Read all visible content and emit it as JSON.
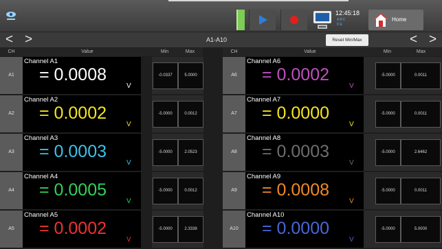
{
  "toolbar": {
    "time": "12:45:18",
    "status_lines": [
      "ABC",
      "DE"
    ],
    "home_label": "Home",
    "icons": [
      "eye-icon",
      "play-icon",
      "record-icon",
      "computer-icon",
      "home-icon"
    ],
    "accent": "#7ecb55"
  },
  "nav": {
    "range": "A1-A10",
    "reset_label": "Reset Min/Max",
    "prev": "<",
    "next": ">"
  },
  "headers": {
    "ch": "CH",
    "value": "Value",
    "min": "Min",
    "max": "Max"
  },
  "channels_left": [
    {
      "id": "A1",
      "name": "Channel A1",
      "value": "= 0.0008",
      "unit": "V",
      "min": "-0.0337",
      "max": "5.0000",
      "color": "#ffffff",
      "unit_color": "#ffffff"
    },
    {
      "id": "A2",
      "name": "Channel A2",
      "value": "= 0.0002",
      "unit": "V",
      "min": "-5.0000",
      "max": "0.0012",
      "color": "#f5e61e",
      "unit_color": "#f5e61e"
    },
    {
      "id": "A3",
      "name": "Channel A3",
      "value": "= 0.0003",
      "unit": "V",
      "min": "-5.0000",
      "max": "2.0523",
      "color": "#3bc3e8",
      "unit_color": "#3bc3e8"
    },
    {
      "id": "A4",
      "name": "Channel A4",
      "value": "= 0.0005",
      "unit": "V",
      "min": "-5.0000",
      "max": "0.0012",
      "color": "#32d05a",
      "unit_color": "#32d05a"
    },
    {
      "id": "A5",
      "name": "Channel A5",
      "value": "= 0.0002",
      "unit": "V",
      "min": "-5.0000",
      "max": "2.3338",
      "color": "#ef3232",
      "unit_color": "#ef3232"
    }
  ],
  "channels_right": [
    {
      "id": "A6",
      "name": "Channel A6",
      "value": "= 0.0002",
      "unit": "V",
      "min": "-5.0000",
      "max": "0.0011",
      "color": "#c04fc0",
      "unit_color": "#c04fc0"
    },
    {
      "id": "A7",
      "name": "Channel A7",
      "value": "= 0.0000",
      "unit": "V",
      "min": "-5.0000",
      "max": "0.0011",
      "color": "#f5e61e",
      "unit_color": "#f5e61e"
    },
    {
      "id": "A8",
      "name": "Channel A8",
      "value": "= 0.0003",
      "unit": "V",
      "min": "-5.0000",
      "max": "2.6462",
      "color": "#6e6e6e",
      "unit_color": "#6e6e6e"
    },
    {
      "id": "A9",
      "name": "Channel A9",
      "value": "= 0.0008",
      "unit": "V",
      "min": "-5.0000",
      "max": "0.0011",
      "color": "#f08a24",
      "unit_color": "#f08a24"
    },
    {
      "id": "A10",
      "name": "Channel A10",
      "value": "= 0.0000",
      "unit": "V",
      "min": "-5.0000",
      "max": "5.0000",
      "color": "#4a66d8",
      "unit_color": "#4a66d8"
    }
  ]
}
